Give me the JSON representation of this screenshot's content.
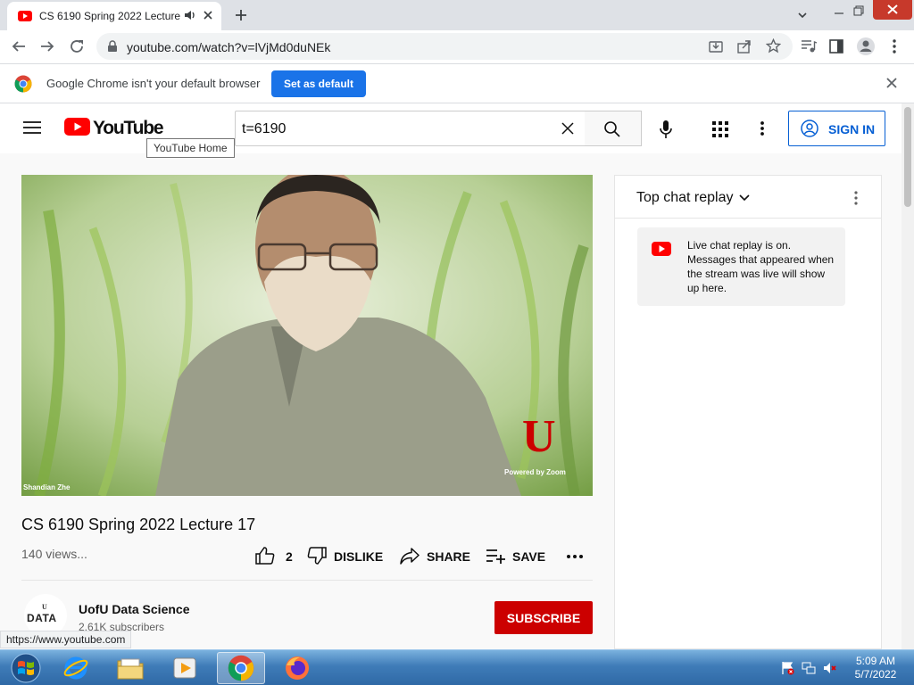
{
  "browser": {
    "tab_title": "CS 6190 Spring 2022 Lecture",
    "url": "youtube.com/watch?v=lVjMd0duNEk",
    "infobar_text": "Google Chrome isn't your default browser",
    "set_default_label": "Set as default",
    "status_url": "https://www.youtube.com"
  },
  "header": {
    "logo_text": "YouTube",
    "search_value": "t=6190",
    "signin_label": "SIGN IN",
    "tooltip": "YouTube Home"
  },
  "video": {
    "name_tag": "Shandian Zhe",
    "watermark_letter": "U",
    "watermark_text": "Powered by Zoom",
    "title": "CS 6190 Spring 2022 Lecture 17",
    "views": "140 views...",
    "like_count": "2",
    "dislike_label": "DISLIKE",
    "share_label": "SHARE",
    "save_label": "SAVE"
  },
  "channel": {
    "avatar_text": "DATA",
    "name": "UofU Data Science",
    "subscribers": "2.61K subscribers",
    "subscribe_label": "SUBSCRIBE"
  },
  "chat": {
    "title": "Top chat replay",
    "message": "Live chat replay is on. Messages that appeared when the stream was live will show up here."
  },
  "taskbar": {
    "time": "5:09 AM",
    "date": "5/7/2022"
  },
  "colors": {
    "youtube_red": "#ff0000",
    "chrome_blue": "#1a73e8",
    "signin_blue": "#065fd4",
    "subscribe_red": "#cc0000"
  }
}
